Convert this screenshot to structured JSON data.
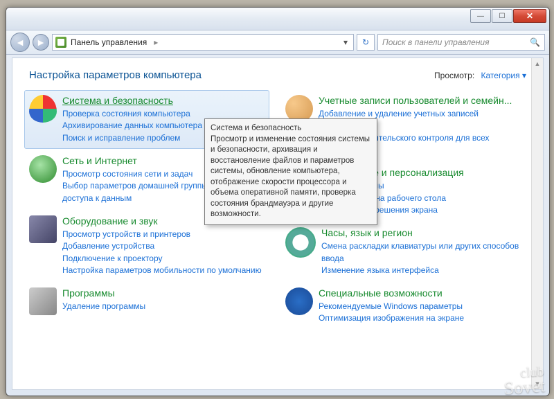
{
  "window_controls": {
    "minimize": "—",
    "maximize": "☐",
    "close": "✕"
  },
  "nav": {
    "back": "◄",
    "forward": "►",
    "breadcrumb": "Панель управления",
    "breadcrumb_sep": "▸",
    "dropdown": "▾",
    "refresh": "↻"
  },
  "search": {
    "placeholder": "Поиск в панели управления",
    "icon": "🔍"
  },
  "header": {
    "title": "Настройка параметров компьютера",
    "view_label": "Просмотр:",
    "view_value": "Категория",
    "view_caret": "▾"
  },
  "categories": {
    "system_security": {
      "title": "Система и безопасность",
      "links": [
        "Проверка состояния компьютера",
        "Архивирование данных компьютера",
        "Поиск и исправление проблем"
      ]
    },
    "network": {
      "title": "Сеть и Интернет",
      "links": [
        "Просмотр состояния сети и задач",
        "Выбор параметров домашней группы и общего доступа к данным"
      ]
    },
    "hardware": {
      "title": "Оборудование и звук",
      "links": [
        "Просмотр устройств и принтеров",
        "Добавление устройства",
        "Подключение к проектору",
        "Настройка параметров мобильности по умолчанию"
      ]
    },
    "programs": {
      "title": "Программы",
      "links": [
        "Удаление программы"
      ]
    },
    "users": {
      "title": "Учетные записи пользователей и семейн...",
      "links": [
        "Добавление и удаление учетных записей пользователей",
        "Установка родительского контроля для всех пользователей"
      ]
    },
    "appearance": {
      "title": "Оформление и персонализация",
      "links": [
        "Изменение темы",
        "Изменение фона рабочего стола",
        "Настройка разрешения экрана"
      ]
    },
    "clock": {
      "title": "Часы, язык и регион",
      "links": [
        "Смена раскладки клавиатуры или других способов ввода",
        "Изменение языка интерфейса"
      ]
    },
    "access": {
      "title": "Специальные возможности",
      "links": [
        "Рекомендуемые Windows параметры",
        "Оптимизация изображения на экране"
      ]
    }
  },
  "tooltip": {
    "title": "Система и безопасность",
    "body": "Просмотр и изменение состояния системы и безопасности, архивация и восстановление файлов и параметров системы, обновление компьютера, отображение скорости процессора и объема оперативной памяти, проверка состояния брандмауэра и другие возможности."
  },
  "watermark": {
    "line1": "club",
    "line2": "Sovet"
  }
}
